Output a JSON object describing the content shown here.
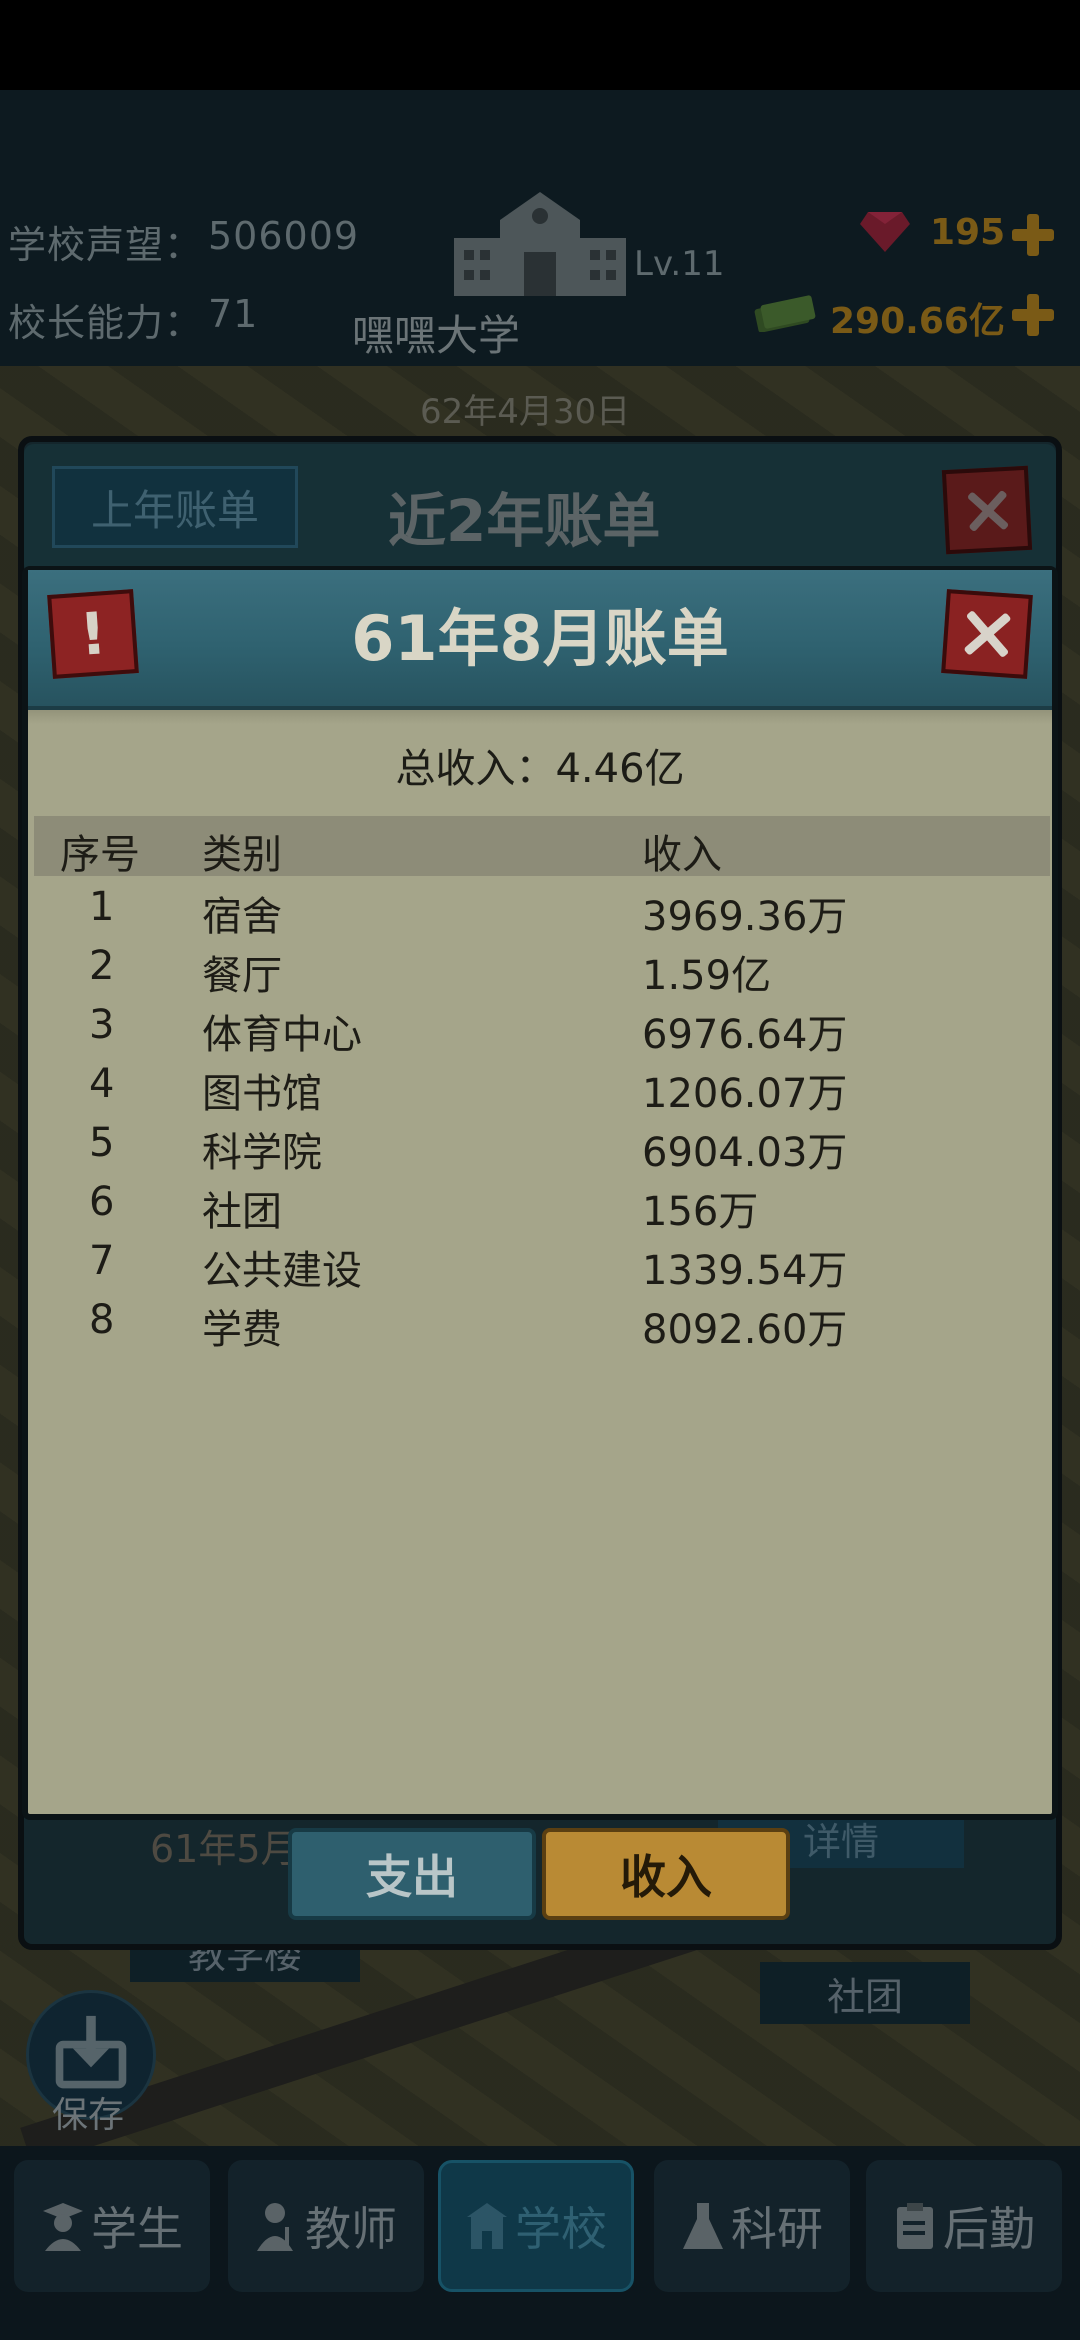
{
  "hud": {
    "reputation_label": "学校声望：",
    "reputation_value": "506009",
    "principal_label": "校长能力：",
    "principal_value": "71",
    "school_name": "嘿嘿大学",
    "level": "Lv.11",
    "gems": "195",
    "money": "290.66亿",
    "date": "62年4月30日"
  },
  "background_dialog": {
    "title": "近2年账单",
    "prev_year_button": "上年账单",
    "row_partial": "61年5月",
    "detail_button": "详情"
  },
  "map_tags": {
    "teaching_building": "教学楼",
    "club": "社团"
  },
  "save_label": "保存",
  "bill": {
    "title": "61年8月账单",
    "total_label": "总收入：",
    "total_value": "4.46亿",
    "columns": [
      "序号",
      "类别",
      "收入"
    ],
    "rows": [
      {
        "no": "1",
        "category": "宿舍",
        "income": "3969.36万"
      },
      {
        "no": "2",
        "category": "餐厅",
        "income": "1.59亿"
      },
      {
        "no": "3",
        "category": "体育中心",
        "income": "6976.64万"
      },
      {
        "no": "4",
        "category": "图书馆",
        "income": "1206.07万"
      },
      {
        "no": "5",
        "category": "科学院",
        "income": "6904.03万"
      },
      {
        "no": "6",
        "category": "社团",
        "income": "156万"
      },
      {
        "no": "7",
        "category": "公共建设",
        "income": "1339.54万"
      },
      {
        "no": "8",
        "category": "学费",
        "income": "8092.60万"
      }
    ],
    "tab_expense": "支出",
    "tab_income": "收入"
  },
  "nav": {
    "students": "学生",
    "teachers": "教师",
    "school": "学校",
    "research": "科研",
    "logistics": "后勤"
  },
  "colors": {
    "dialog_bg": "#a5a58a",
    "header_teal": "#2f6270",
    "income_tab": "#b98a34",
    "close_red": "#8a2222"
  }
}
